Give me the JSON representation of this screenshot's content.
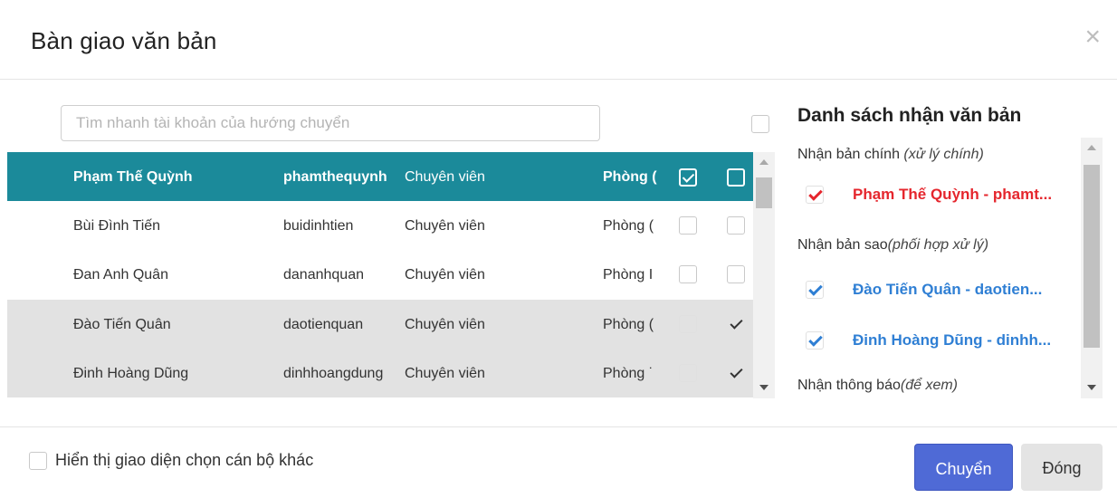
{
  "dialog": {
    "title": "Bàn giao văn bản",
    "close_label": "×"
  },
  "search": {
    "placeholder": "Tìm nhanh tài khoản của hướng chuyển"
  },
  "table": {
    "rows": [
      {
        "name": "Phạm Thế Quỳnh",
        "username": "phamthequynh",
        "role": "Chuyên viên",
        "dept": "Phòng (",
        "selected": true,
        "main_checked": true,
        "copy_checked": false
      },
      {
        "name": "Bùi Đình Tiến",
        "username": "buidinhtien",
        "role": "Chuyên viên",
        "dept": "Phòng (",
        "main_checked": false,
        "copy_checked": false
      },
      {
        "name": "Đan Anh Quân",
        "username": "dananhquan",
        "role": "Chuyên viên",
        "dept": "Phòng I",
        "main_checked": false,
        "copy_checked": false
      },
      {
        "name": "Đào Tiến Quân",
        "username": "daotienquan",
        "role": "Chuyên viên",
        "dept": "Phòng (",
        "main_checked": false,
        "copy_checked": true
      },
      {
        "name": "Đinh Hoàng Dũng",
        "username": "dinhhoangdung",
        "role": "Chuyên viên",
        "dept": "Phòng ˙",
        "main_checked": false,
        "copy_checked": true
      }
    ]
  },
  "recipients": {
    "title": "Danh sách nhận văn bản",
    "main": {
      "label": "Nhận bản chính ",
      "note": "(xử lý chính)",
      "items": [
        "Phạm Thế Quỳnh - phamt..."
      ]
    },
    "copy": {
      "label": "Nhận bản sao",
      "note": "(phối hợp xử lý)",
      "items": [
        "Đào Tiến Quân - daotien...",
        "Đinh Hoàng Dũng - dinhh..."
      ]
    },
    "notify": {
      "label": "Nhận thông báo",
      "note": "(để xem)"
    }
  },
  "footer": {
    "show_other_label": "Hiển thị giao diện chọn cán bộ khác",
    "transfer_button": "Chuyển",
    "close_button": "Đóng"
  },
  "colors": {
    "selected_row": "#1b8a9a",
    "primary_button": "#4f6ad6",
    "main_recipient": "#e5262d",
    "copy_recipient": "#2f7fd4"
  }
}
